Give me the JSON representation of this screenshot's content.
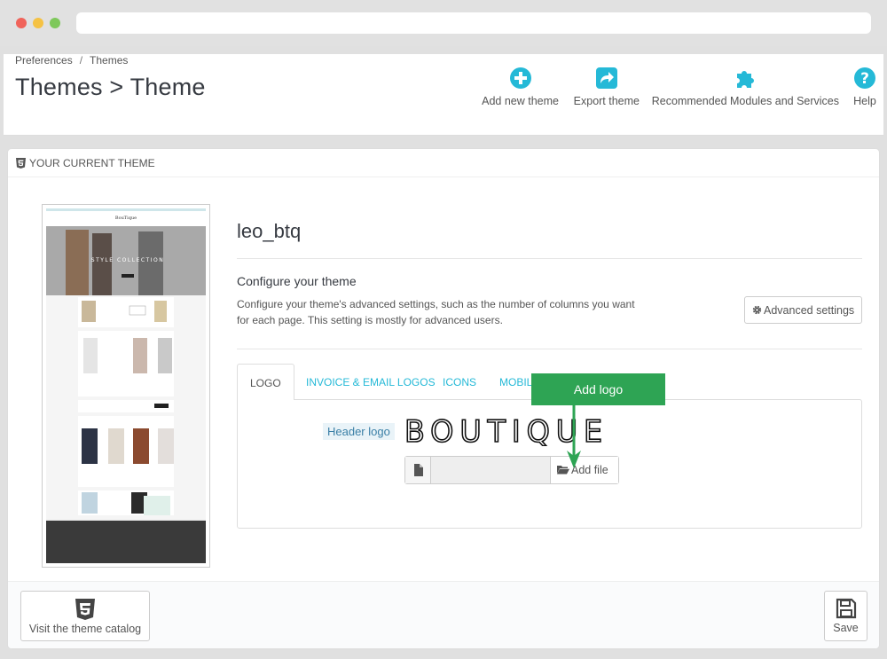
{
  "breadcrumb": {
    "first": "Preferences",
    "separator": "/",
    "second": "Themes"
  },
  "page_title": "Themes > Theme",
  "toolbar": {
    "add_new_theme": "Add new theme",
    "export_theme": "Export theme",
    "recommended_modules": "Recommended Modules and Services",
    "help": "Help"
  },
  "colors": {
    "accent": "#25b9d7",
    "callout": "#2ea454"
  },
  "panel": {
    "heading": "YOUR CURRENT THEME"
  },
  "theme": {
    "name": "leo_btq",
    "configure_title": "Configure your theme",
    "configure_desc": "Configure your theme's advanced settings, such as the number of columns you want for each page. This setting is mostly for advanced users.",
    "advanced_settings": "Advanced settings"
  },
  "tabs": {
    "logo": "LOGO",
    "invoice_email": "INVOICE & EMAIL LOGOS",
    "icons": "ICONS",
    "mobile": "MOBIL"
  },
  "logo_tab": {
    "header_logo_label": "Header logo",
    "logo_text": "BOUTIQUE",
    "add_file": "Add file"
  },
  "callout": {
    "text": "Add logo"
  },
  "preview": {
    "hero_text": "STYLE COLLECTION",
    "brand": "BouTique"
  },
  "footer": {
    "catalog_button": "Visit the theme catalog",
    "save_button": "Save"
  },
  "icons": {
    "add": "plus-circle-icon",
    "export": "share-icon",
    "modules": "puzzle-icon",
    "help": "question-circle-icon",
    "html5": "html5-icon",
    "gear": "gear-icon",
    "file": "file-icon",
    "folder": "folder-open-icon",
    "save": "floppy-disk-icon"
  }
}
